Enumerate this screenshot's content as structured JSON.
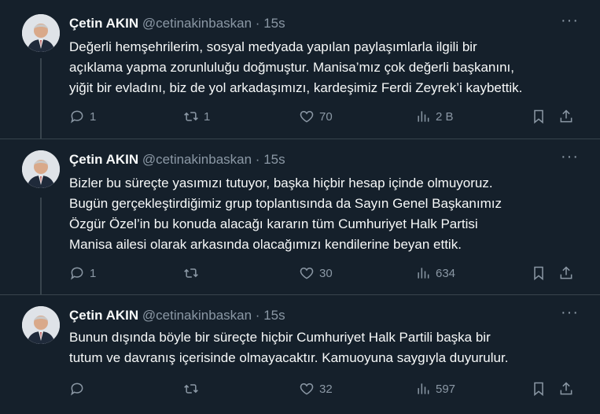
{
  "tweets": [
    {
      "name": "Çetin AKIN",
      "handle": "@cetinakinbaskan",
      "separator": "·",
      "time": "15s",
      "more": "···",
      "lines": [
        "Değerli hemşehrilerim, sosyal medyada yapılan paylaşımlarla ilgili bir",
        "açıklama yapma zorunluluğu doğmuştur. Manisa’mız çok değerli başkanını,",
        "yiğit bir evladını, biz de yol arkadaşımızı, kardeşimiz Ferdi Zeyrek’i kaybettik."
      ],
      "replies": "1",
      "retweets": "1",
      "likes": "70",
      "views": "2 B"
    },
    {
      "name": "Çetin AKIN",
      "handle": "@cetinakinbaskan",
      "separator": "·",
      "time": "15s",
      "more": "···",
      "lines": [
        "Bizler bu süreçte yasımızı tutuyor, başka hiçbir hesap içinde olmuyoruz.",
        "Bugün gerçekleştirdiğimiz grup toplantısında da Sayın Genel Başkanımız",
        "Özgür Özel’in bu konuda alacağı kararın tüm Cumhuriyet Halk Partisi",
        "Manisa ailesi olarak arkasında olacağımızı kendilerine beyan ettik."
      ],
      "replies": "1",
      "retweets": "",
      "likes": "30",
      "views": "634"
    },
    {
      "name": "Çetin AKIN",
      "handle": "@cetinakinbaskan",
      "separator": "·",
      "time": "15s",
      "more": "···",
      "lines": [
        "Bunun dışında böyle bir süreçte hiçbir Cumhuriyet Halk Partili başka bir",
        "tutum ve davranış içerisinde olmayacaktır. Kamuoyuna saygıyla duyurulur."
      ],
      "replies": "",
      "retweets": "",
      "likes": "32",
      "views": "597"
    }
  ],
  "icons": {
    "reply": "reply-icon",
    "retweet": "retweet-icon",
    "like": "heart-icon",
    "views": "views-icon",
    "bookmark": "bookmark-icon",
    "share": "share-icon"
  },
  "colors": {
    "background": "#15202b",
    "text": "#f7f9f9",
    "secondary": "#8b98a5",
    "border": "#38444d"
  }
}
